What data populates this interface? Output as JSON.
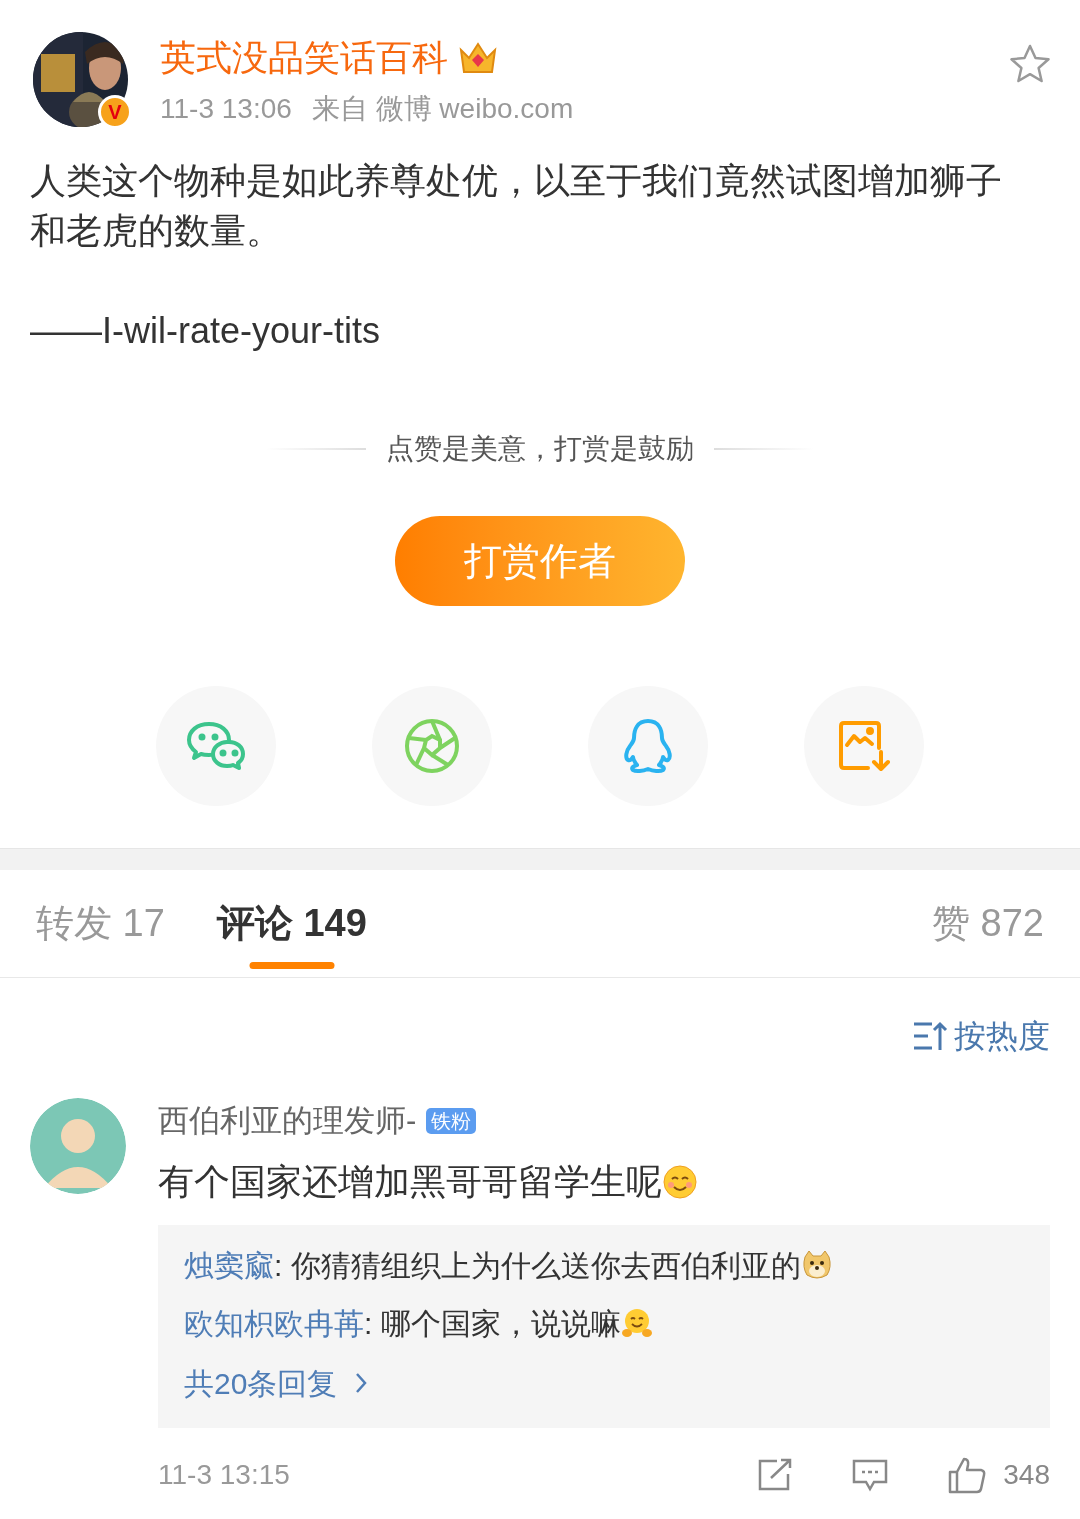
{
  "post": {
    "avatar": {
      "kind": "picture"
    },
    "verified_mark": "V",
    "author": "英式没品笑话百科",
    "time": "11-3 13:06",
    "source": "来自 微博 weibo.com",
    "favorited": false,
    "paragraphs": [
      "人类这个物种是如此养尊处优，以至于我们竟然试图增加狮子和老虎的数量。",
      "——I-wil-rate-your-tits"
    ]
  },
  "reward": {
    "caption": "点赞是美意，打赏是鼓励",
    "button": "打赏作者"
  },
  "share": [
    {
      "kind": "wechat"
    },
    {
      "kind": "moments"
    },
    {
      "kind": "qq"
    },
    {
      "kind": "save"
    }
  ],
  "tabs": [
    {
      "label": "转发 17",
      "selected": false
    },
    {
      "label": "评论 149",
      "selected": true
    },
    {
      "label": "赞 872",
      "selected": false
    }
  ],
  "sort": "按热度",
  "comments": [
    {
      "user": "西伯利亚的理发师-",
      "badge": "铁粉",
      "text": "有个国家还增加黑哥哥留学生呢",
      "emoji": {
        "kind": "smile"
      },
      "replies": [
        {
          "user": "烛窦窳",
          "text": ": 你猜猜组织上为什么送你去西伯利亚的",
          "emoji": {
            "kind": "doge"
          }
        },
        {
          "user": "欧知枳欧冉苒",
          "text": ": 哪个国家，说说嘛",
          "emoji": {
            "kind": "hug"
          }
        }
      ],
      "more": "共20条回复",
      "time": "11-3 13:15",
      "likes": "348"
    }
  ]
}
